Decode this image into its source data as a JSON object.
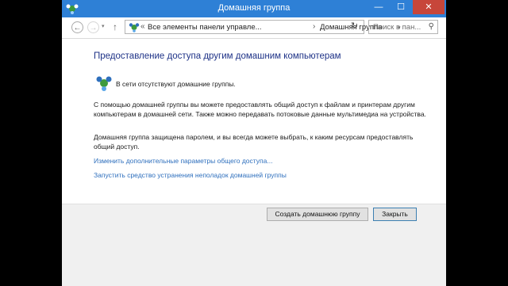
{
  "window": {
    "title": "Домашняя группа",
    "controls": {
      "minimize": "—",
      "maximize": "☐",
      "close": "✕"
    }
  },
  "nav": {
    "back": "←",
    "forward": "→",
    "dropdown": "▾",
    "up": "↑",
    "address": {
      "separator": "«",
      "arrow": "›",
      "segment1": "Все элементы панели управле...",
      "segment2": "Домашняя группа",
      "dropdown": "▾"
    },
    "refresh": "↻",
    "search_placeholder": "Поиск в пан...",
    "search_icon": "⚲"
  },
  "content": {
    "heading": "Предоставление доступа другим домашним компьютерам",
    "status": "В сети отсутствуют домашние группы.",
    "paragraph1": "С помощью домашней группы вы можете предоставлять общий доступ к файлам и принтерам другим компьютерам в домашней сети. Также можно передавать потоковые данные мультимедиа на устройства.",
    "paragraph2": "Домашняя группа защищена паролем, и вы всегда можете выбрать, к каким ресурсам предоставлять общий доступ.",
    "link1": "Изменить дополнительные параметры общего доступа...",
    "link2": "Запустить средство устранения неполадок домашней группы"
  },
  "footer": {
    "create_button": "Создать домашнюю группу",
    "close_button": "Закрыть"
  },
  "colors": {
    "titlebar": "#2e80d6",
    "close_button": "#c7463a",
    "heading": "#1e3287",
    "link": "#2e6fbd"
  },
  "icons": {
    "title": "homegroup-icon",
    "address": "homegroup-icon",
    "status": "homegroup-icon"
  }
}
